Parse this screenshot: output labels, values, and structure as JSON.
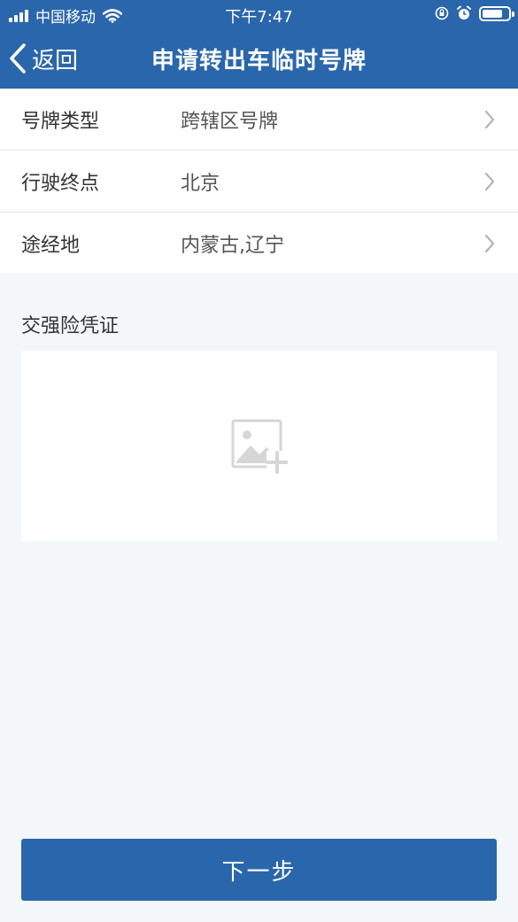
{
  "status_bar": {
    "carrier": "中国移动",
    "time": "下午7:47"
  },
  "nav": {
    "back_label": "返回",
    "title": "申请转出车临时号牌"
  },
  "form": {
    "rows": [
      {
        "label": "号牌类型",
        "value": "跨辖区号牌"
      },
      {
        "label": "行驶终点",
        "value": "北京"
      },
      {
        "label": "途经地",
        "value": "内蒙古,辽宁"
      }
    ]
  },
  "insurance": {
    "title": "交强险凭证"
  },
  "footer": {
    "next_label": "下一步"
  },
  "colors": {
    "header": "#2a66ab",
    "background": "#f3f7fa",
    "button": "#2a66ab"
  }
}
